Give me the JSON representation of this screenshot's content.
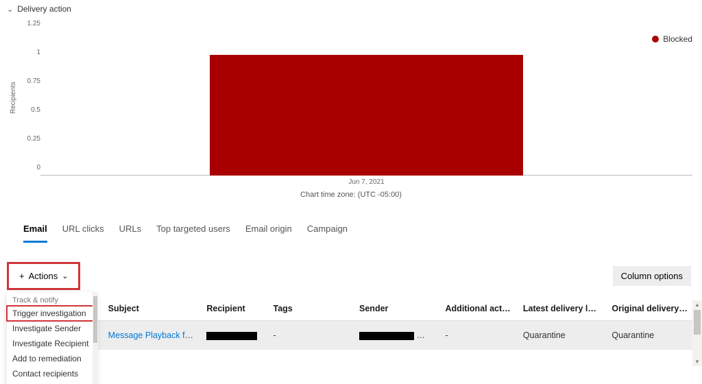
{
  "section_title": "Delivery action",
  "legend": {
    "label": "Blocked",
    "color": "#a80000"
  },
  "y_axis_label": "Recipients",
  "chart_tz": "Chart time zone: (UTC -05:00)",
  "chart_data": {
    "type": "bar",
    "categories": [
      "Jun 7, 2021"
    ],
    "series": [
      {
        "name": "Blocked",
        "values": [
          1
        ]
      }
    ],
    "ylabel": "Recipients",
    "xlabel": "",
    "ylim": [
      0,
      1.25
    ],
    "yticks": [
      1.25,
      1,
      0.75,
      0.5,
      0.25,
      0
    ]
  },
  "tabs": [
    {
      "label": "Email",
      "active": true
    },
    {
      "label": "URL clicks",
      "active": false
    },
    {
      "label": "URLs",
      "active": false
    },
    {
      "label": "Top targeted users",
      "active": false
    },
    {
      "label": "Email origin",
      "active": false
    },
    {
      "label": "Campaign",
      "active": false
    }
  ],
  "toolbar": {
    "actions_label": "Actions",
    "column_options_label": "Column options"
  },
  "actions_menu": {
    "group": "Track & notify",
    "items": [
      "Trigger investigation",
      "Investigate Sender",
      "Investigate Recipient",
      "Add to remediation",
      "Contact recipients"
    ]
  },
  "table": {
    "headers": [
      "",
      "Subject",
      "Recipient",
      "Tags",
      "Sender",
      "Additional actions",
      "Latest delivery location",
      "Original delivery locatio…"
    ],
    "rows": [
      {
        "subject_prefix": "Message Playback for",
        "tags": "-",
        "sender_suffix": "…",
        "additional_actions": "-",
        "latest_delivery_location": "Quarantine",
        "original_delivery_location": "Quarantine"
      }
    ]
  }
}
